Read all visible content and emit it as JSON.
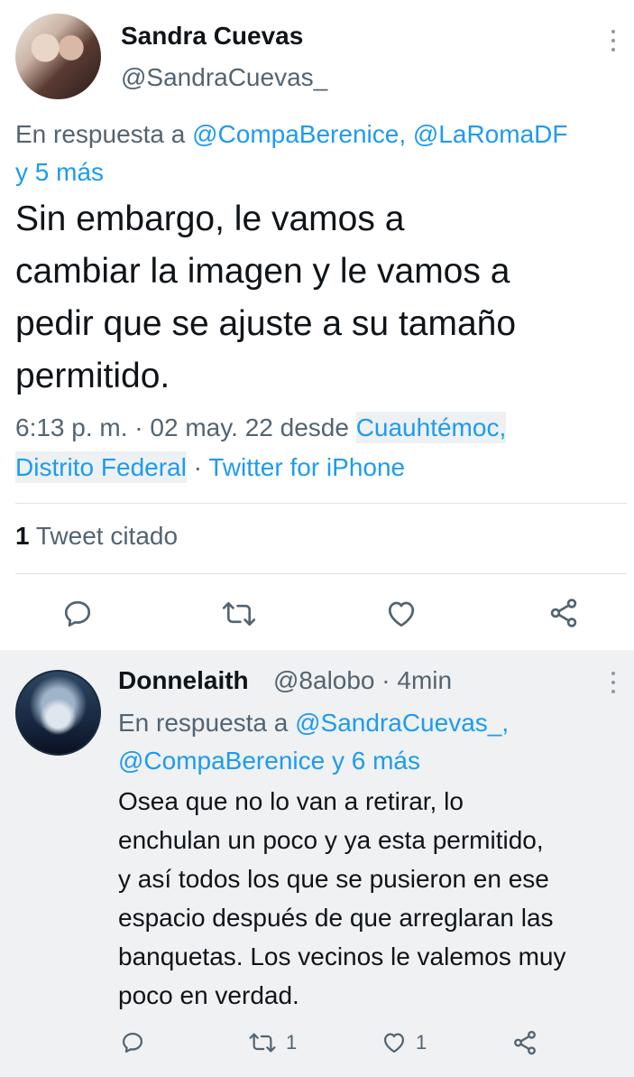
{
  "main_tweet": {
    "author_name": "Sandra Cuevas",
    "author_handle": "@SandraCuevas_",
    "reply_prefix": "En respuesta a ",
    "reply_mentions": "@CompaBerenice, @LaRomaDF",
    "reply_more": "y 5 más",
    "text_lines": [
      "Sin embargo, le vamos a",
      "cambiar la imagen y le vamos a",
      "pedir que se ajuste a su tamaño",
      "permitido."
    ],
    "time": "6:13 p. m. · 02 may. 22 desde ",
    "location_line1": "Cuauhtémoc,",
    "location_line2": "Distrito Federal",
    "separator": " · ",
    "source": "Twitter for iPhone",
    "quoted_count": "1",
    "quoted_label": " Tweet citado"
  },
  "reply_tweet": {
    "author_name": "Donnelaith",
    "author_handle": "@8alobo",
    "time_ago": " · 4min",
    "reply_prefix": "En respuesta a ",
    "reply_mention1": "@SandraCuevas_,",
    "reply_mention2": "@CompaBerenice y 6 más",
    "text_lines": [
      "Osea que no lo van a  retirar, lo",
      "enchulan un poco y ya esta permitido,",
      "y así todos los que se pusieron en ese",
      "espacio después de que arreglaran las",
      "banquetas. Los vecinos le valemos muy",
      "poco en verdad."
    ],
    "retweet_count": "1",
    "like_count": "1"
  },
  "icons": [
    "reply-icon",
    "retweet-icon",
    "like-icon",
    "share-icon",
    "more-icon"
  ],
  "colors": {
    "link": "#1d9bf0",
    "muted": "#536471",
    "text": "#0f1419",
    "reply_bg": "#eff1f3"
  }
}
